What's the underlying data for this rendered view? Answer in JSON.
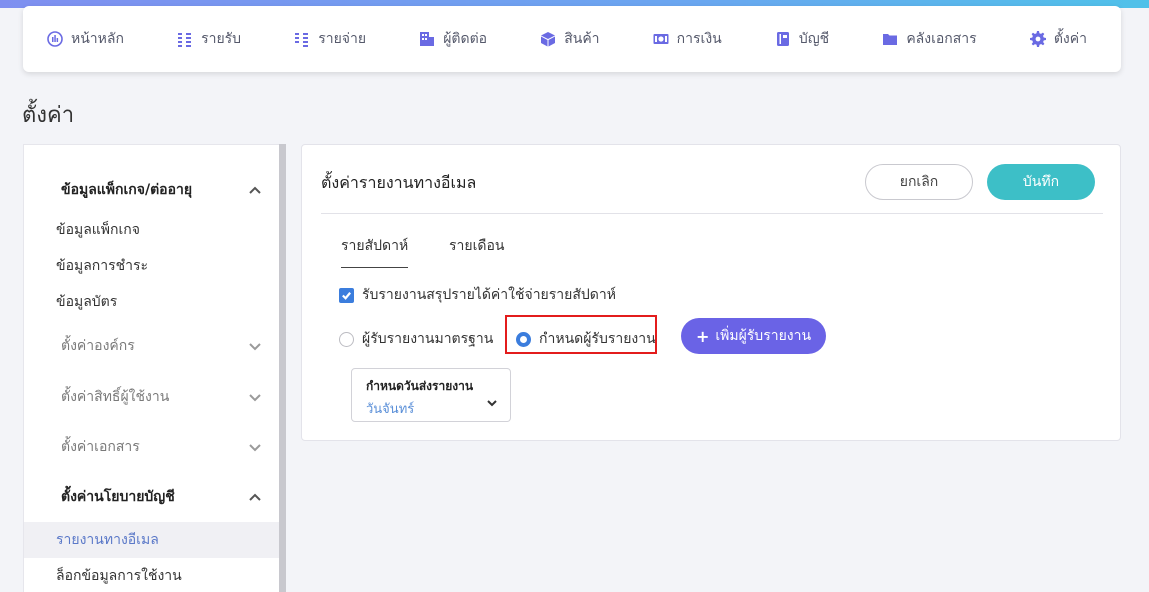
{
  "nav": [
    {
      "label": "หน้าหลัก",
      "icon": "chart-pie-icon"
    },
    {
      "label": "รายรับ",
      "icon": "income-icon"
    },
    {
      "label": "รายจ่าย",
      "icon": "expense-icon"
    },
    {
      "label": "ผู้ติดต่อ",
      "icon": "contacts-building-icon"
    },
    {
      "label": "สินค้า",
      "icon": "product-box-icon"
    },
    {
      "label": "การเงิน",
      "icon": "money-icon"
    },
    {
      "label": "บัญชี",
      "icon": "account-book-icon"
    },
    {
      "label": "คลังเอกสาร",
      "icon": "folder-icon"
    },
    {
      "label": "ตั้งค่า",
      "icon": "gear-icon"
    }
  ],
  "page_title": "ตั้งค่า",
  "sidebar": {
    "package_group": "ข้อมูลแพ็กเกจ/ต่ออายุ",
    "package_items": [
      "ข้อมูลแพ็กเกจ",
      "ข้อมูลการชำระ",
      "ข้อมูลบัตร"
    ],
    "org_group": "ตั้งค่าองค์กร",
    "permission_group": "ตั้งค่าสิทธิ์ผู้ใช้งาน",
    "document_group": "ตั้งค่าเอกสาร",
    "policy_group": "ตั้งค่านโยบายบัญชี",
    "policy_items": [
      "รายงานทางอีเมล",
      "ล็อกข้อมูลการใช้งาน"
    ]
  },
  "panel": {
    "title": "ตั้งค่ารายงานทางอีเมล",
    "cancel_label": "ยกเลิก",
    "save_label": "บันทึก",
    "tabs": [
      "รายสัปดาห์",
      "รายเดือน"
    ],
    "checkbox_label": "รับรายงานสรุปรายได้ค่าใช้จ่ายรายสัปดาห์",
    "radio_standard": "ผู้รับรายงานมาตรฐาน",
    "radio_custom": "กำหนดผู้รับรายงาน",
    "add_label": "เพิ่มผู้รับรายงาน",
    "add_plus": "+",
    "select_label": "กำหนดวันส่งรายงาน",
    "select_value": "วันจันทร์"
  },
  "colors": {
    "accent_purple": "#6a63e6",
    "save_teal": "#3dbfc7",
    "checkbox_blue": "#3b7ddd",
    "highlight_red": "#e31c1c"
  }
}
